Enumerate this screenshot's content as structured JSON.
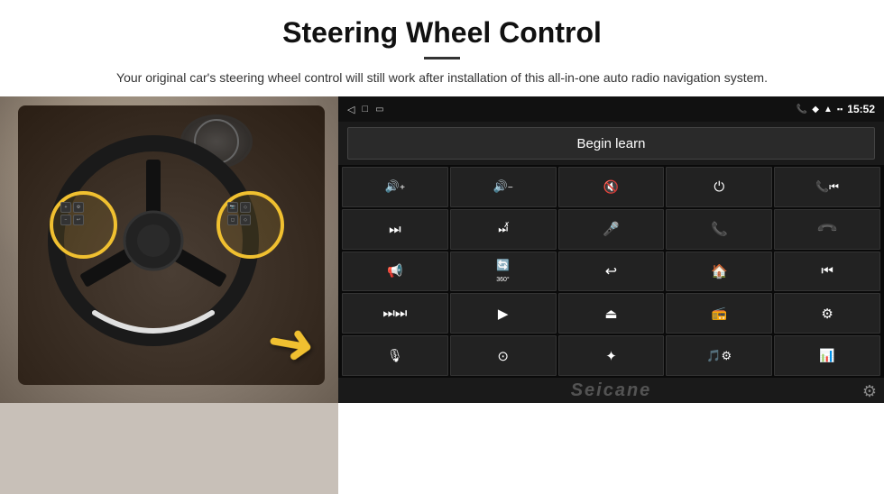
{
  "header": {
    "title": "Steering Wheel Control",
    "subtitle": "Your original car's steering wheel control will still work after installation of this all-in-one auto radio navigation system."
  },
  "android_ui": {
    "status_bar": {
      "back_icon": "◁",
      "home_icon": "□",
      "recents_icon": "▭",
      "battery_icon": "▪",
      "phone_icon": "📞",
      "location_icon": "◆",
      "signal_icon": "▲",
      "time": "15:52"
    },
    "begin_learn_label": "Begin learn",
    "controls": [
      {
        "icon": "🔊+",
        "label": "vol-up"
      },
      {
        "icon": "🔊−",
        "label": "vol-down"
      },
      {
        "icon": "🔇",
        "label": "mute"
      },
      {
        "icon": "⏻",
        "label": "power"
      },
      {
        "icon": "📞⏮",
        "label": "call-prev"
      },
      {
        "icon": "⏭",
        "label": "next-track"
      },
      {
        "icon": "⏭✗",
        "label": "ff-skip"
      },
      {
        "icon": "🎤",
        "label": "mic"
      },
      {
        "icon": "📞",
        "label": "phone"
      },
      {
        "icon": "↩",
        "label": "hang-up"
      },
      {
        "icon": "📢",
        "label": "horn"
      },
      {
        "icon": "⟳360",
        "label": "camera-360"
      },
      {
        "icon": "↩",
        "label": "back"
      },
      {
        "icon": "🏠",
        "label": "home"
      },
      {
        "icon": "⏮⏮",
        "label": "prev-track"
      },
      {
        "icon": "⏭⏭",
        "label": "fast-forward"
      },
      {
        "icon": "▶",
        "label": "play"
      },
      {
        "icon": "⊖",
        "label": "eject"
      },
      {
        "icon": "📻",
        "label": "radio"
      },
      {
        "icon": "⚙",
        "label": "equalizer"
      },
      {
        "icon": "🎙",
        "label": "voice"
      },
      {
        "icon": "⊙",
        "label": "menu"
      },
      {
        "icon": "✦",
        "label": "bluetooth"
      },
      {
        "icon": "♪⚙",
        "label": "music-settings"
      },
      {
        "icon": "📊",
        "label": "spectrum"
      }
    ],
    "watermark": "Seicane",
    "settings_icon": "⚙"
  }
}
